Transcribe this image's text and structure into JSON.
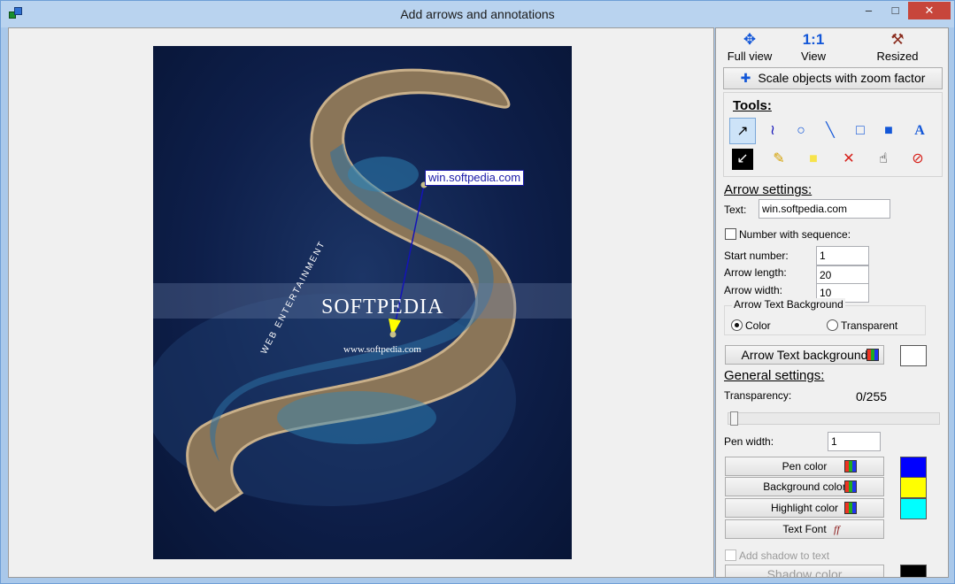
{
  "window": {
    "title": "Add arrows and annotations",
    "minimize": "–",
    "maximize": "□",
    "close": "✕"
  },
  "canvas": {
    "annotation_text": "win.softpedia.com",
    "brand": "SOFTPEDIA",
    "brand_url": "www.softpedia.com",
    "brand_web": "WEB  ENTERTAINMENT",
    "colors": {
      "arrow": "#1414b8",
      "arrow_head": "#ffff00"
    }
  },
  "view_buttons": [
    {
      "label": "Full view",
      "icon": "expand-arrows-icon"
    },
    {
      "label": "View",
      "icon": "one-to-one-icon",
      "icon_text": "1:1"
    },
    {
      "label": "Resized",
      "icon": "resized-icon"
    }
  ],
  "scale_button": {
    "label": "Scale objects with zoom factor",
    "icon": "plus-icon"
  },
  "tools": {
    "label": "Tools:",
    "items": [
      {
        "name": "arrow-tool-icon",
        "glyph": "↗",
        "selected": true
      },
      {
        "name": "freehand-tool-icon",
        "glyph": "≀"
      },
      {
        "name": "circle-tool-icon",
        "glyph": "○"
      },
      {
        "name": "line-tool-icon",
        "glyph": "╲"
      },
      {
        "name": "rectangle-tool-icon",
        "glyph": "□"
      },
      {
        "name": "filled-rectangle-tool-icon",
        "glyph": "■"
      },
      {
        "name": "text-tool-icon",
        "glyph": "A"
      },
      {
        "name": "black-arrow-tool-icon",
        "glyph": "↙"
      },
      {
        "name": "highlighter-tool-icon",
        "glyph": "✎"
      },
      {
        "name": "note-tool-icon",
        "glyph": "■"
      },
      {
        "name": "delete-tool-icon",
        "glyph": "✕"
      },
      {
        "name": "hand-tool-icon",
        "glyph": "☝"
      },
      {
        "name": "clear-tool-icon",
        "glyph": "⊘"
      }
    ]
  },
  "arrow_settings": {
    "title": "Arrow settings:",
    "text_label": "Text:",
    "text_value": "win.softpedia.com",
    "number_with_sequence": "Number with sequence:",
    "start_number_label": "Start number:",
    "start_number": "1",
    "arrow_length_label": "Arrow length:",
    "arrow_length": "20",
    "arrow_width_label": "Arrow width:",
    "arrow_width": "10",
    "text_bg_group": "Arrow Text Background",
    "color_option": "Color",
    "transparent_option": "Transparent",
    "text_bg_button": "Arrow Text background"
  },
  "general_settings": {
    "title": "General settings:",
    "transparency_label": "Transparency:",
    "transparency_value": "0/255",
    "pen_width_label": "Pen width:",
    "pen_width": "1",
    "pen_color": "Pen color",
    "background_color": "Background color",
    "highlight_color": "Highlight color",
    "text_font": "Text Font",
    "add_shadow": "Add shadow to text",
    "shadow_color": "Shadow color",
    "swatches": {
      "arrow_text_bg": "#ffffff",
      "pen": "#0000ff",
      "background": "#ffff00",
      "highlight": "#00ffff",
      "shadow": "#000000"
    }
  }
}
